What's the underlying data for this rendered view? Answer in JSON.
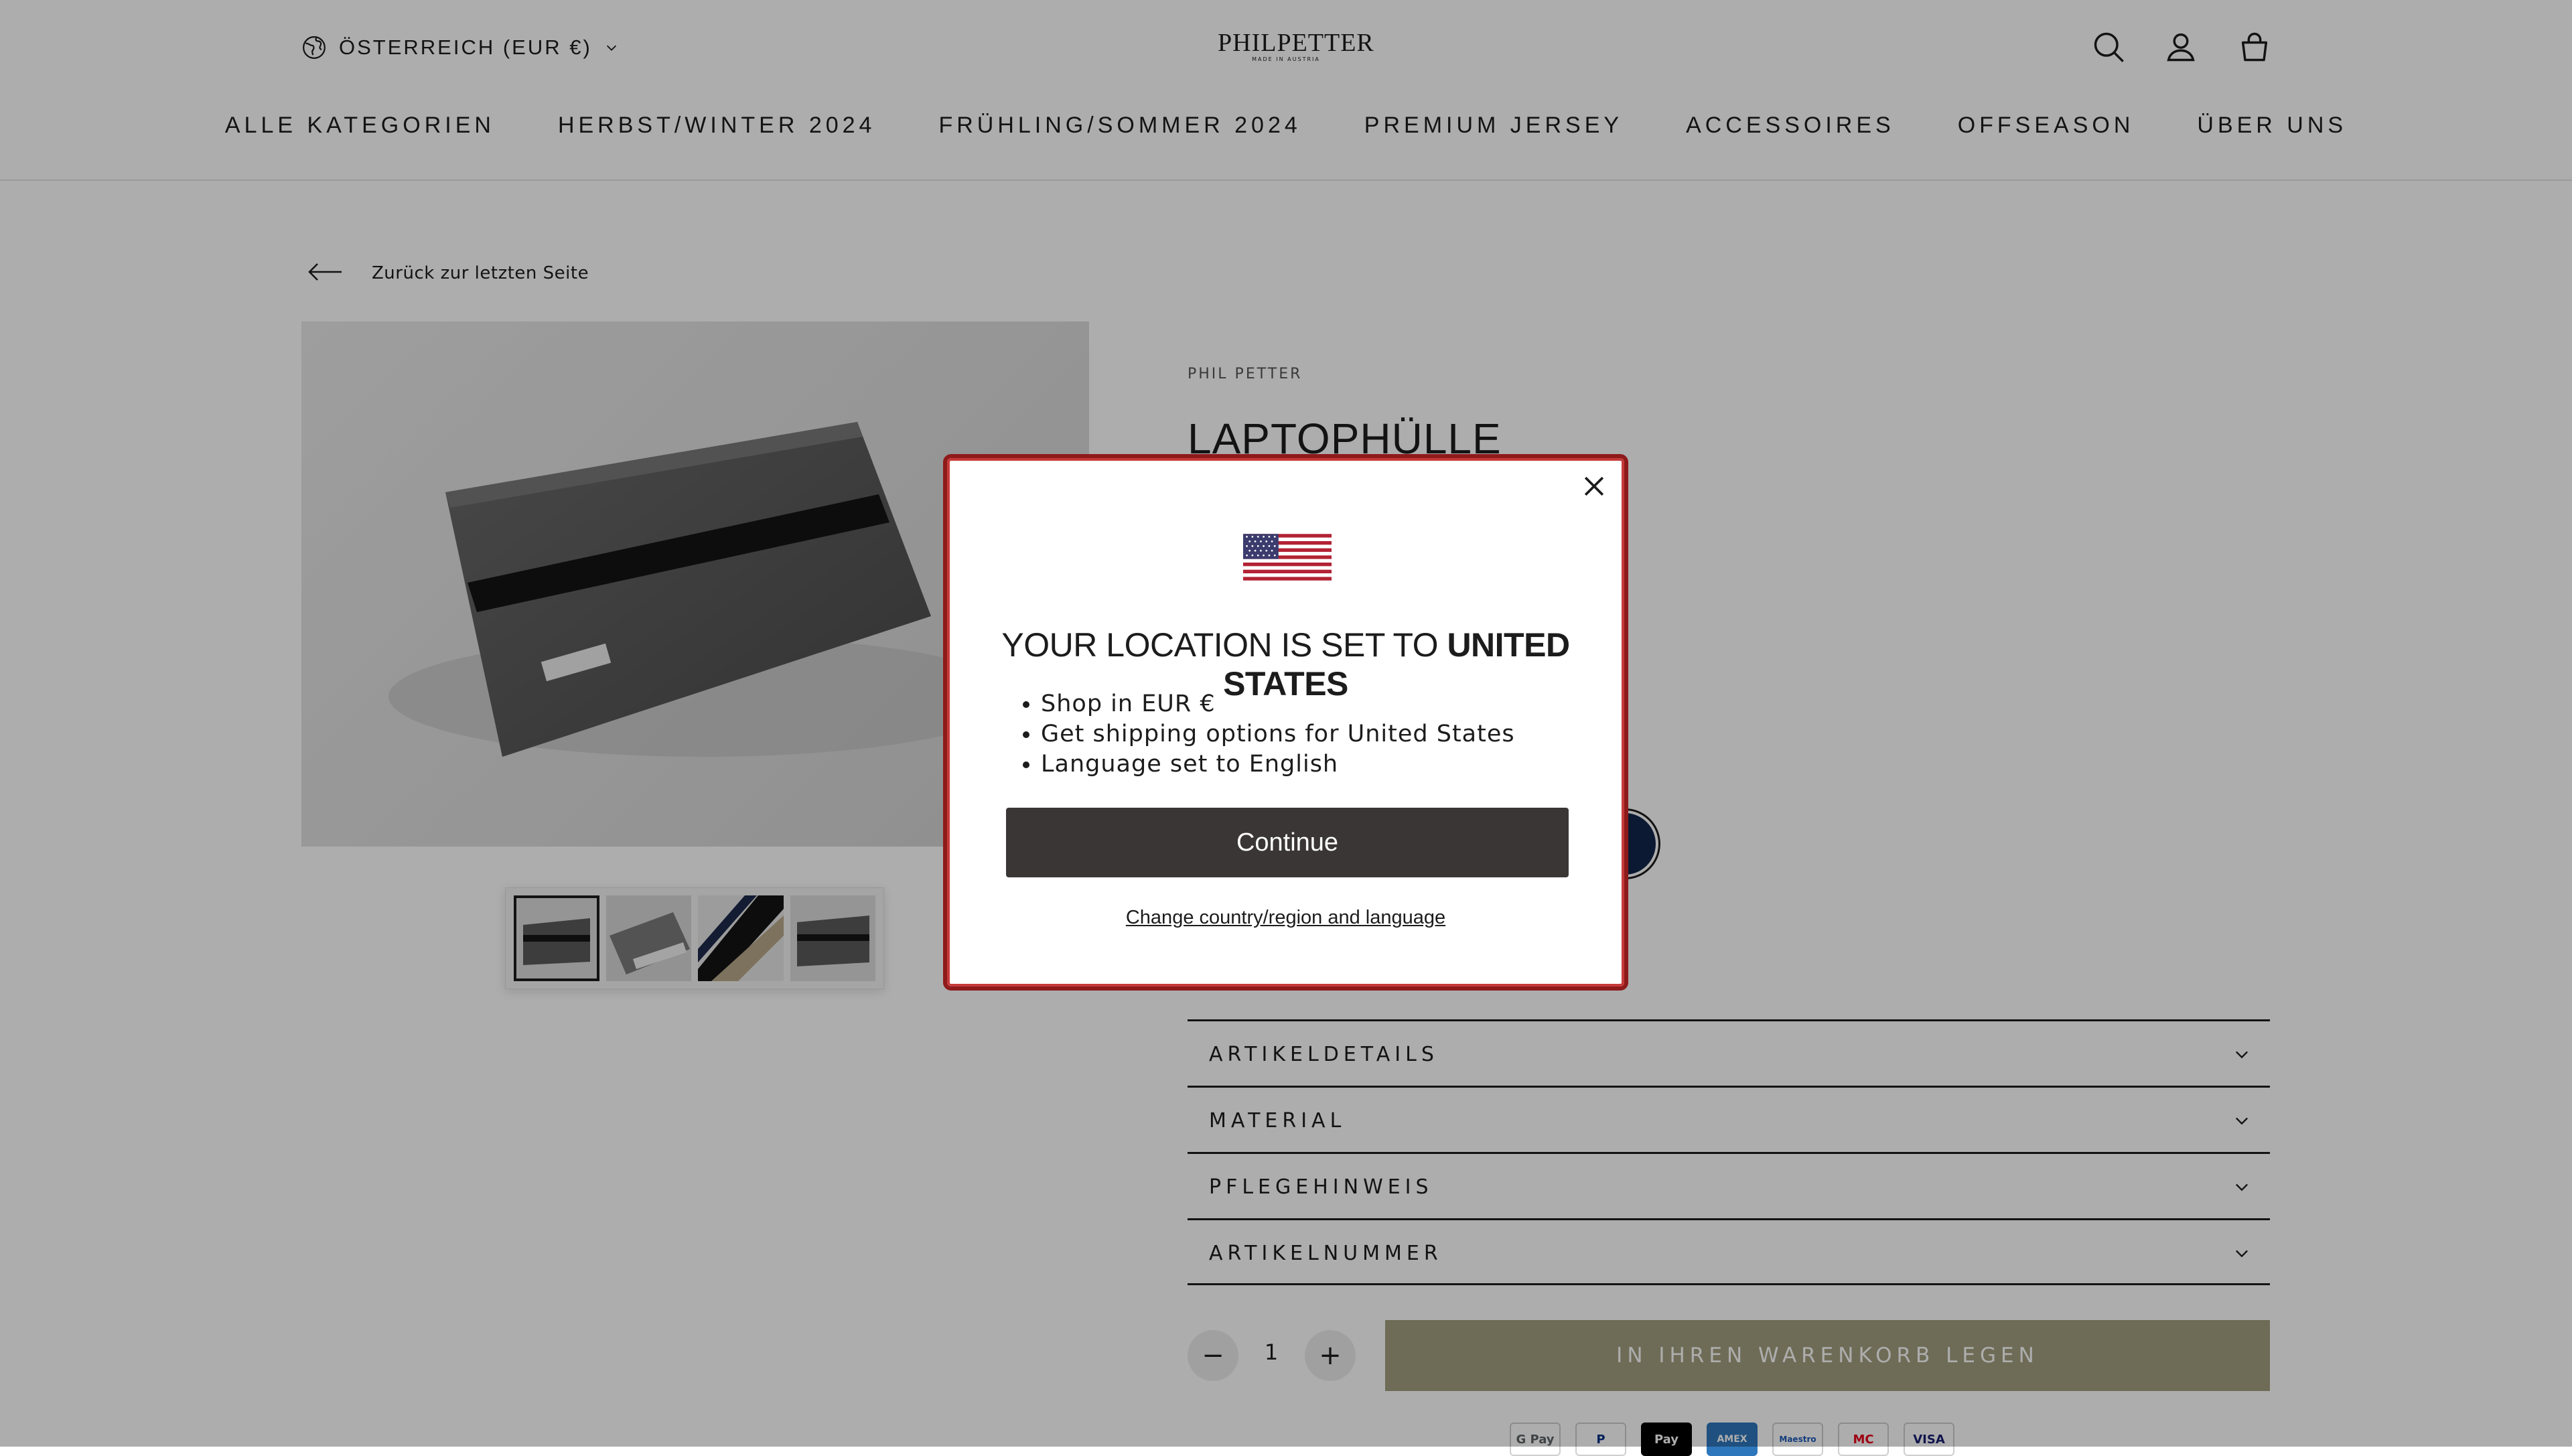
{
  "header": {
    "country_label": "ÖSTERREICH (EUR €)",
    "logo_text": "PHILPETTER",
    "logo_tagline": "MADE IN AUSTRIA"
  },
  "nav": {
    "items": [
      "ALLE KATEGORIEN",
      "HERBST/WINTER 2024",
      "FRÜHLING/SOMMER 2024",
      "PREMIUM JERSEY",
      "ACCESSOIRES",
      "OFFSEASON",
      "ÜBER UNS"
    ]
  },
  "breadcrumb": {
    "back_label": "Zurück zur letzten Seite"
  },
  "product": {
    "vendor": "PHIL PETTER",
    "title": "LAPTOPHÜLLE",
    "swatch_color": "#12264a",
    "accordion": [
      "ARTIKELDETAILS",
      "MATERIAL",
      "PFLEGEHINWEIS",
      "ARTIKELNUMMER"
    ],
    "quantity": "1",
    "minus": "−",
    "plus": "+",
    "add_to_cart": "IN IHREN WARENKORB LEGEN",
    "payment_methods": [
      "G Pay",
      "P",
      "Pay",
      "AMEX",
      "Maestro",
      "MC",
      "VISA"
    ]
  },
  "modal": {
    "title_prefix": "YOUR LOCATION IS SET TO",
    "title_country": "UNITED STATES",
    "bullets": [
      "Shop in EUR €",
      "Get shipping options for United States",
      "Language set to English"
    ],
    "continue_label": "Continue",
    "change_label": "Change country/region and language"
  },
  "colors": {
    "accent_button": "#a2a07f",
    "modal_button": "#3b3636",
    "modal_border": "#8e1a1a"
  }
}
